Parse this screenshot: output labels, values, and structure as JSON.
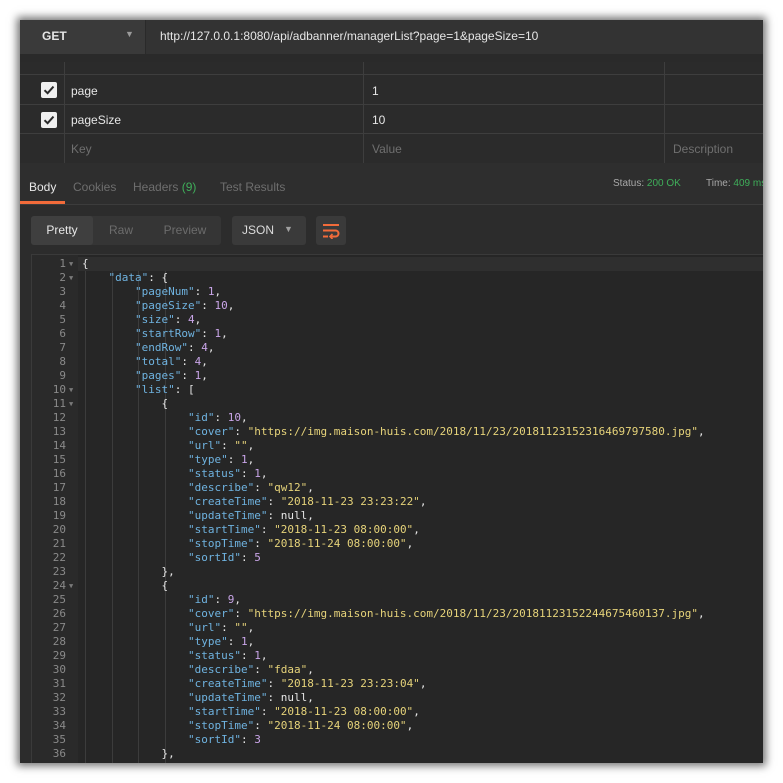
{
  "request": {
    "method": "GET",
    "url": "http://127.0.0.1:8080/api/adbanner/managerList?page=1&pageSize=10"
  },
  "params": {
    "rows": [
      {
        "key": "page",
        "value": "1",
        "checked": true
      },
      {
        "key": "pageSize",
        "value": "10",
        "checked": true
      }
    ],
    "placeholder": {
      "key": "Key",
      "value": "Value",
      "description": "Description"
    }
  },
  "response_tabs": {
    "body": "Body",
    "cookies": "Cookies",
    "headers": "Headers",
    "headers_count": "(9)",
    "test_results": "Test Results",
    "status_label": "Status:",
    "status_value": "200 OK",
    "time_label": "Time:",
    "time_value": "409 ms"
  },
  "format_toolbar": {
    "pretty": "Pretty",
    "raw": "Raw",
    "preview": "Preview",
    "format": "JSON"
  },
  "code_lines": [
    {
      "n": "1",
      "fold": true,
      "indent": 0,
      "t": [
        [
          "p",
          "{"
        ]
      ]
    },
    {
      "n": "2",
      "fold": true,
      "indent": 1,
      "t": [
        [
          "k",
          "\"data\""
        ],
        [
          "p",
          ": {"
        ]
      ]
    },
    {
      "n": "3",
      "indent": 2,
      "t": [
        [
          "k",
          "\"pageNum\""
        ],
        [
          "p",
          ": "
        ],
        [
          "n",
          "1"
        ],
        [
          "p",
          ","
        ]
      ]
    },
    {
      "n": "4",
      "indent": 2,
      "t": [
        [
          "k",
          "\"pageSize\""
        ],
        [
          "p",
          ": "
        ],
        [
          "n",
          "10"
        ],
        [
          "p",
          ","
        ]
      ]
    },
    {
      "n": "5",
      "indent": 2,
      "t": [
        [
          "k",
          "\"size\""
        ],
        [
          "p",
          ": "
        ],
        [
          "n",
          "4"
        ],
        [
          "p",
          ","
        ]
      ]
    },
    {
      "n": "6",
      "indent": 2,
      "t": [
        [
          "k",
          "\"startRow\""
        ],
        [
          "p",
          ": "
        ],
        [
          "n",
          "1"
        ],
        [
          "p",
          ","
        ]
      ]
    },
    {
      "n": "7",
      "indent": 2,
      "t": [
        [
          "k",
          "\"endRow\""
        ],
        [
          "p",
          ": "
        ],
        [
          "n",
          "4"
        ],
        [
          "p",
          ","
        ]
      ]
    },
    {
      "n": "8",
      "indent": 2,
      "t": [
        [
          "k",
          "\"total\""
        ],
        [
          "p",
          ": "
        ],
        [
          "n",
          "4"
        ],
        [
          "p",
          ","
        ]
      ]
    },
    {
      "n": "9",
      "indent": 2,
      "t": [
        [
          "k",
          "\"pages\""
        ],
        [
          "p",
          ": "
        ],
        [
          "n",
          "1"
        ],
        [
          "p",
          ","
        ]
      ]
    },
    {
      "n": "10",
      "fold": true,
      "indent": 2,
      "t": [
        [
          "k",
          "\"list\""
        ],
        [
          "p",
          ": ["
        ]
      ]
    },
    {
      "n": "11",
      "fold": true,
      "indent": 3,
      "t": [
        [
          "p",
          "{"
        ]
      ]
    },
    {
      "n": "12",
      "indent": 4,
      "t": [
        [
          "k",
          "\"id\""
        ],
        [
          "p",
          ": "
        ],
        [
          "n",
          "10"
        ],
        [
          "p",
          ","
        ]
      ]
    },
    {
      "n": "13",
      "indent": 4,
      "t": [
        [
          "k",
          "\"cover\""
        ],
        [
          "p",
          ": "
        ],
        [
          "s",
          "\"https://img.maison-huis.com/2018/11/23/20181123152316469797580.jpg\""
        ],
        [
          "p",
          ","
        ]
      ]
    },
    {
      "n": "14",
      "indent": 4,
      "t": [
        [
          "k",
          "\"url\""
        ],
        [
          "p",
          ": "
        ],
        [
          "s",
          "\"\""
        ],
        [
          "p",
          ","
        ]
      ]
    },
    {
      "n": "15",
      "indent": 4,
      "t": [
        [
          "k",
          "\"type\""
        ],
        [
          "p",
          ": "
        ],
        [
          "n",
          "1"
        ],
        [
          "p",
          ","
        ]
      ]
    },
    {
      "n": "16",
      "indent": 4,
      "t": [
        [
          "k",
          "\"status\""
        ],
        [
          "p",
          ": "
        ],
        [
          "n",
          "1"
        ],
        [
          "p",
          ","
        ]
      ]
    },
    {
      "n": "17",
      "indent": 4,
      "t": [
        [
          "k",
          "\"describe\""
        ],
        [
          "p",
          ": "
        ],
        [
          "s",
          "\"qw12\""
        ],
        [
          "p",
          ","
        ]
      ]
    },
    {
      "n": "18",
      "indent": 4,
      "t": [
        [
          "k",
          "\"createTime\""
        ],
        [
          "p",
          ": "
        ],
        [
          "s",
          "\"2018-11-23 23:23:22\""
        ],
        [
          "p",
          ","
        ]
      ]
    },
    {
      "n": "19",
      "indent": 4,
      "t": [
        [
          "k",
          "\"updateTime\""
        ],
        [
          "p",
          ": "
        ],
        [
          "nl",
          "null"
        ],
        [
          "p",
          ","
        ]
      ]
    },
    {
      "n": "20",
      "indent": 4,
      "t": [
        [
          "k",
          "\"startTime\""
        ],
        [
          "p",
          ": "
        ],
        [
          "s",
          "\"2018-11-23 08:00:00\""
        ],
        [
          "p",
          ","
        ]
      ]
    },
    {
      "n": "21",
      "indent": 4,
      "t": [
        [
          "k",
          "\"stopTime\""
        ],
        [
          "p",
          ": "
        ],
        [
          "s",
          "\"2018-11-24 08:00:00\""
        ],
        [
          "p",
          ","
        ]
      ]
    },
    {
      "n": "22",
      "indent": 4,
      "t": [
        [
          "k",
          "\"sortId\""
        ],
        [
          "p",
          ": "
        ],
        [
          "n",
          "5"
        ]
      ]
    },
    {
      "n": "23",
      "indent": 3,
      "t": [
        [
          "p",
          "},"
        ]
      ]
    },
    {
      "n": "24",
      "fold": true,
      "indent": 3,
      "t": [
        [
          "p",
          "{"
        ]
      ]
    },
    {
      "n": "25",
      "indent": 4,
      "t": [
        [
          "k",
          "\"id\""
        ],
        [
          "p",
          ": "
        ],
        [
          "n",
          "9"
        ],
        [
          "p",
          ","
        ]
      ]
    },
    {
      "n": "26",
      "indent": 4,
      "t": [
        [
          "k",
          "\"cover\""
        ],
        [
          "p",
          ": "
        ],
        [
          "s",
          "\"https://img.maison-huis.com/2018/11/23/20181123152244675460137.jpg\""
        ],
        [
          "p",
          ","
        ]
      ]
    },
    {
      "n": "27",
      "indent": 4,
      "t": [
        [
          "k",
          "\"url\""
        ],
        [
          "p",
          ": "
        ],
        [
          "s",
          "\"\""
        ],
        [
          "p",
          ","
        ]
      ]
    },
    {
      "n": "28",
      "indent": 4,
      "t": [
        [
          "k",
          "\"type\""
        ],
        [
          "p",
          ": "
        ],
        [
          "n",
          "1"
        ],
        [
          "p",
          ","
        ]
      ]
    },
    {
      "n": "29",
      "indent": 4,
      "t": [
        [
          "k",
          "\"status\""
        ],
        [
          "p",
          ": "
        ],
        [
          "n",
          "1"
        ],
        [
          "p",
          ","
        ]
      ]
    },
    {
      "n": "30",
      "indent": 4,
      "t": [
        [
          "k",
          "\"describe\""
        ],
        [
          "p",
          ": "
        ],
        [
          "s",
          "\"fdaa\""
        ],
        [
          "p",
          ","
        ]
      ]
    },
    {
      "n": "31",
      "indent": 4,
      "t": [
        [
          "k",
          "\"createTime\""
        ],
        [
          "p",
          ": "
        ],
        [
          "s",
          "\"2018-11-23 23:23:04\""
        ],
        [
          "p",
          ","
        ]
      ]
    },
    {
      "n": "32",
      "indent": 4,
      "t": [
        [
          "k",
          "\"updateTime\""
        ],
        [
          "p",
          ": "
        ],
        [
          "nl",
          "null"
        ],
        [
          "p",
          ","
        ]
      ]
    },
    {
      "n": "33",
      "indent": 4,
      "t": [
        [
          "k",
          "\"startTime\""
        ],
        [
          "p",
          ": "
        ],
        [
          "s",
          "\"2018-11-23 08:00:00\""
        ],
        [
          "p",
          ","
        ]
      ]
    },
    {
      "n": "34",
      "indent": 4,
      "t": [
        [
          "k",
          "\"stopTime\""
        ],
        [
          "p",
          ": "
        ],
        [
          "s",
          "\"2018-11-24 08:00:00\""
        ],
        [
          "p",
          ","
        ]
      ]
    },
    {
      "n": "35",
      "indent": 4,
      "t": [
        [
          "k",
          "\"sortId\""
        ],
        [
          "p",
          ": "
        ],
        [
          "n",
          "3"
        ]
      ]
    },
    {
      "n": "36",
      "indent": 3,
      "t": [
        [
          "p",
          "},"
        ]
      ]
    }
  ]
}
